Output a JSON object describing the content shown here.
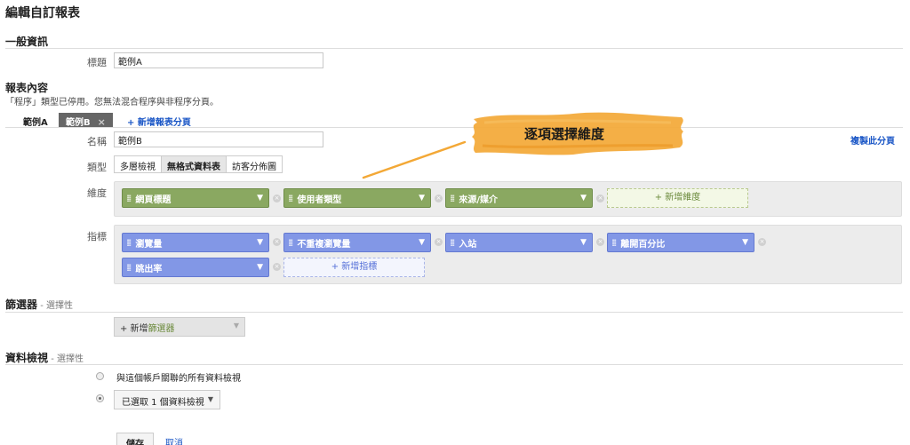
{
  "page": {
    "title": "編輯自訂報表"
  },
  "general": {
    "heading": "一般資訊",
    "title_label": "標題",
    "title_value": "範例A"
  },
  "content": {
    "heading": "報表內容",
    "note": "「程序」類型已停用。您無法混合程序與非程序分頁。",
    "tabs": [
      {
        "label": "範例A"
      },
      {
        "label": "範例B",
        "close": "×"
      }
    ],
    "add_tab_label": "+ 新增報表分頁",
    "copy_tab_label": "複製此分頁",
    "name_label": "名稱",
    "name_value": "範例B",
    "type_label": "類型",
    "types": [
      "多層檢視",
      "無格式資料表",
      "訪客分佈圖"
    ],
    "dimensions_label": "維度",
    "dimensions": [
      "網頁標題",
      "使用者類型",
      "來源/媒介"
    ],
    "add_dimension_label": "+ 新增維度",
    "metrics_label": "指標",
    "metrics": [
      "瀏覽量",
      "不重複瀏覽量",
      "入站",
      "離開百分比",
      "跳出率"
    ],
    "add_metric_label": "+ 新增指標"
  },
  "filters": {
    "heading": "篩選器",
    "optional": " - 選擇性",
    "add_prefix": "+ 新增",
    "add_emph": "篩選器"
  },
  "views": {
    "heading": "資料檢視",
    "optional": " - 選擇性",
    "option_all": "與這個帳戶關聯的所有資料檢視",
    "option_selected": "已選取 1 個資料檢視",
    "selected_option": "option_selected"
  },
  "actions": {
    "save": "儲存",
    "cancel": "取消"
  },
  "annotation": {
    "text": "逐項選擇維度",
    "color": "#f3a836"
  },
  "colors": {
    "dimension": "#8aa861",
    "metric": "#8297e6",
    "link": "#1a56c6"
  },
  "icons": {
    "grip": "grip-icon",
    "caret": "caret-down-icon",
    "remove": "remove-icon",
    "close": "close-icon"
  }
}
